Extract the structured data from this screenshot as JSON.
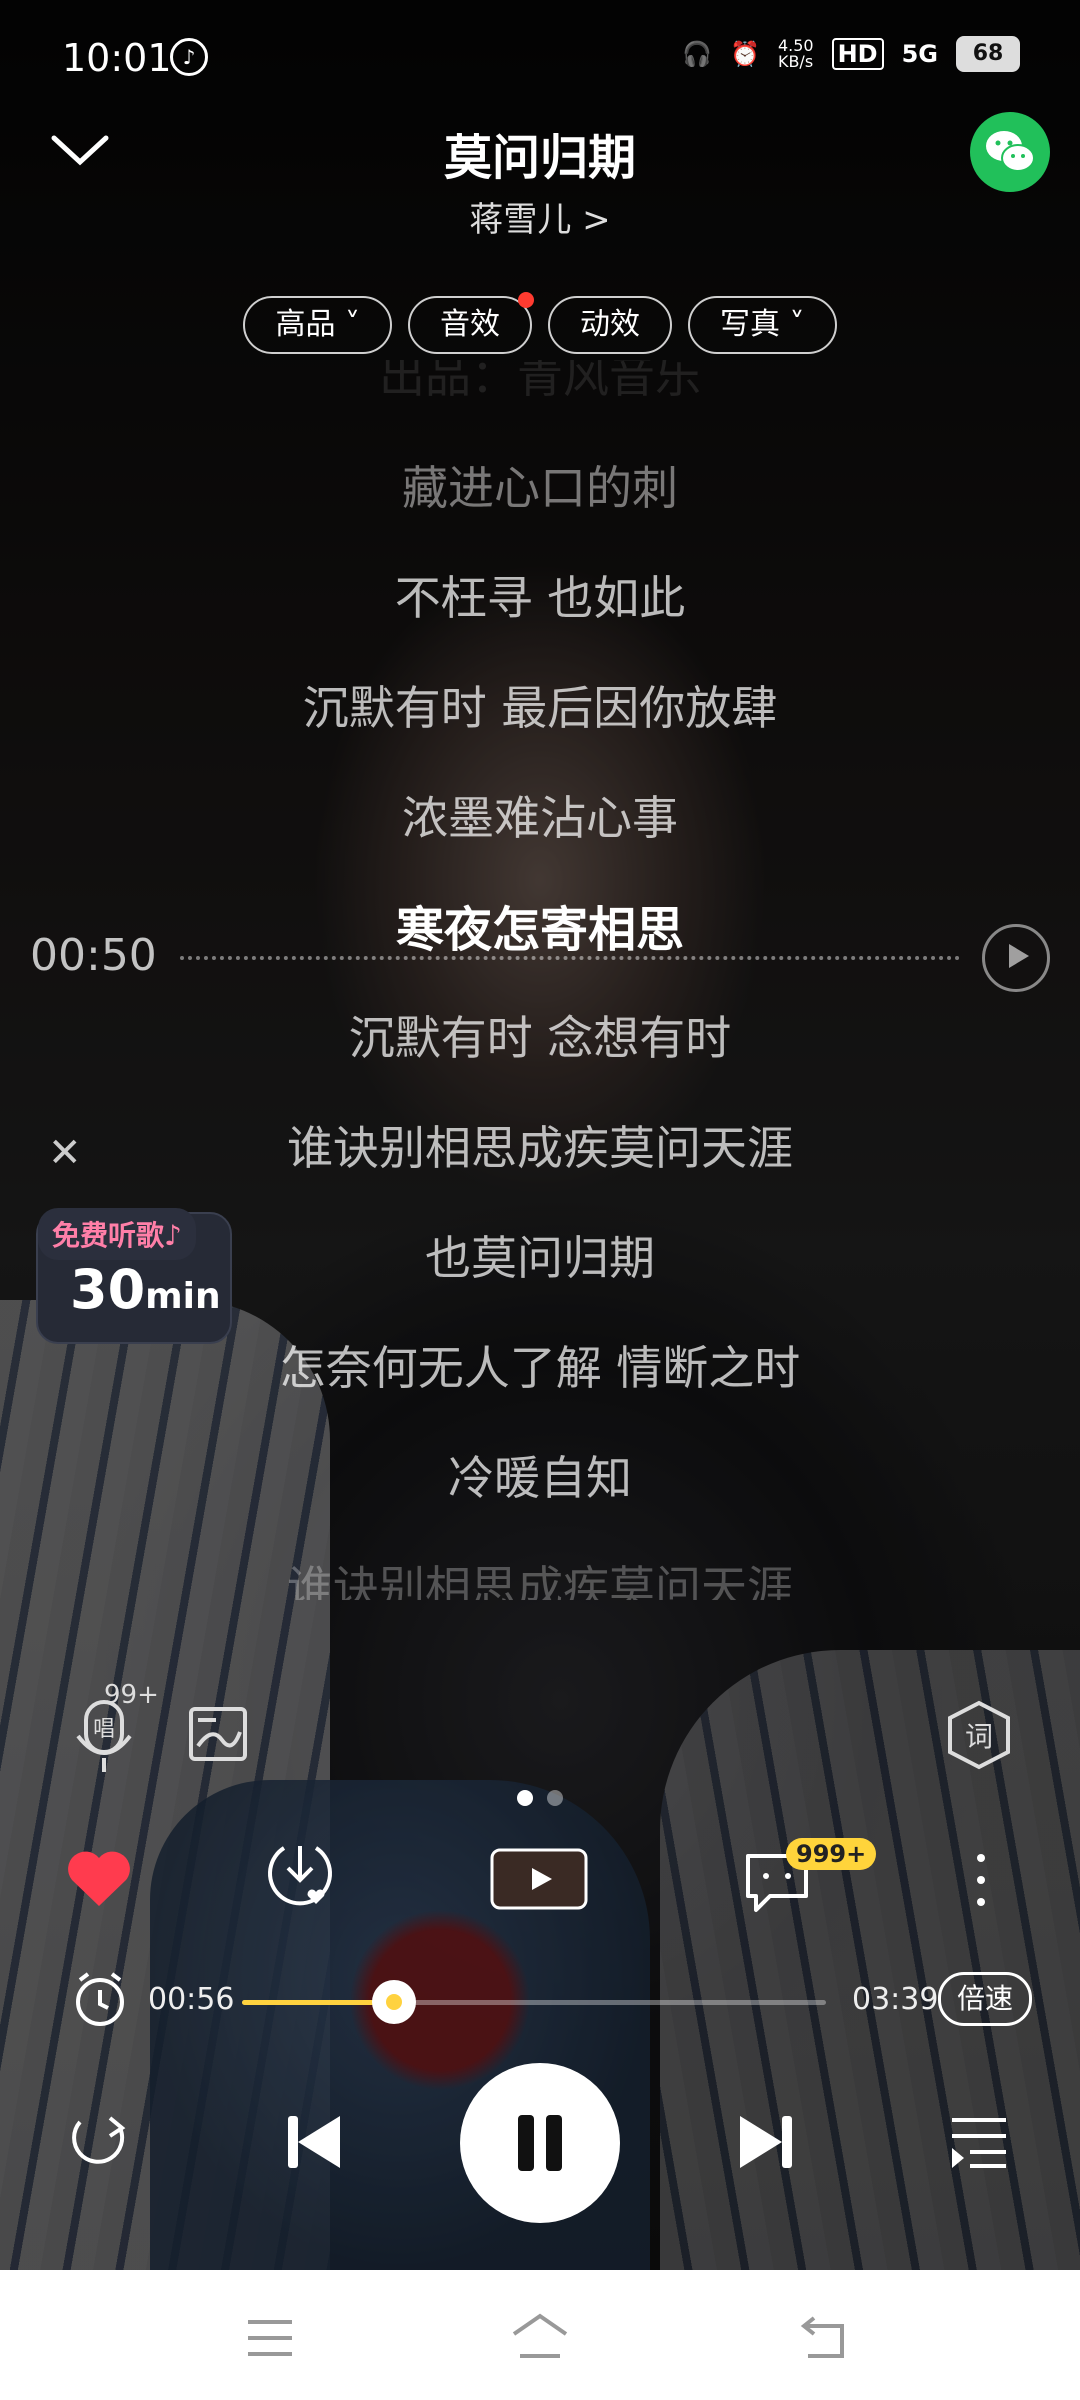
{
  "status_bar": {
    "time": "10:01",
    "net_speed": "4.50\nKB/s",
    "hd": "HD",
    "signal": "5G",
    "battery": "68"
  },
  "header": {
    "title": "莫问归期",
    "artist": "蒋雪儿 >"
  },
  "chips": [
    {
      "label": "高品 ˅"
    },
    {
      "label": "音效"
    },
    {
      "label": "动效"
    },
    {
      "label": "写真 ˅"
    }
  ],
  "lyrics": [
    {
      "text": "出品：青风音乐"
    },
    {
      "text": "藏进心口的刺"
    },
    {
      "text": "不枉寻  也如此"
    },
    {
      "text": "沉默有时  最后因你放肆"
    },
    {
      "text": "浓墨难沾心事"
    },
    {
      "text": "寒夜怎寄相思"
    },
    {
      "text": "沉默有时  念想有时"
    },
    {
      "text": "谁诀别相思成疾莫问天涯"
    },
    {
      "text": "也莫问归期"
    },
    {
      "text": "怎奈何无人了解  情断之时"
    },
    {
      "text": "冷暖自知"
    },
    {
      "text": "谁诀别相思成疾莫问天涯"
    }
  ],
  "lyric_seek_time": "00:50",
  "promo": {
    "label": "免费听歌♪",
    "minutes": "30",
    "unit": "min"
  },
  "tools": {
    "sing_count": "99+"
  },
  "actions": {
    "comment_count": "999+"
  },
  "progress": {
    "current": "00:56",
    "total": "03:39",
    "fraction": 0.26
  },
  "speed_label": "倍速",
  "colors": {
    "accent": "#ffd23f",
    "heart": "#ff3b4e",
    "wechat": "#21c05a"
  }
}
